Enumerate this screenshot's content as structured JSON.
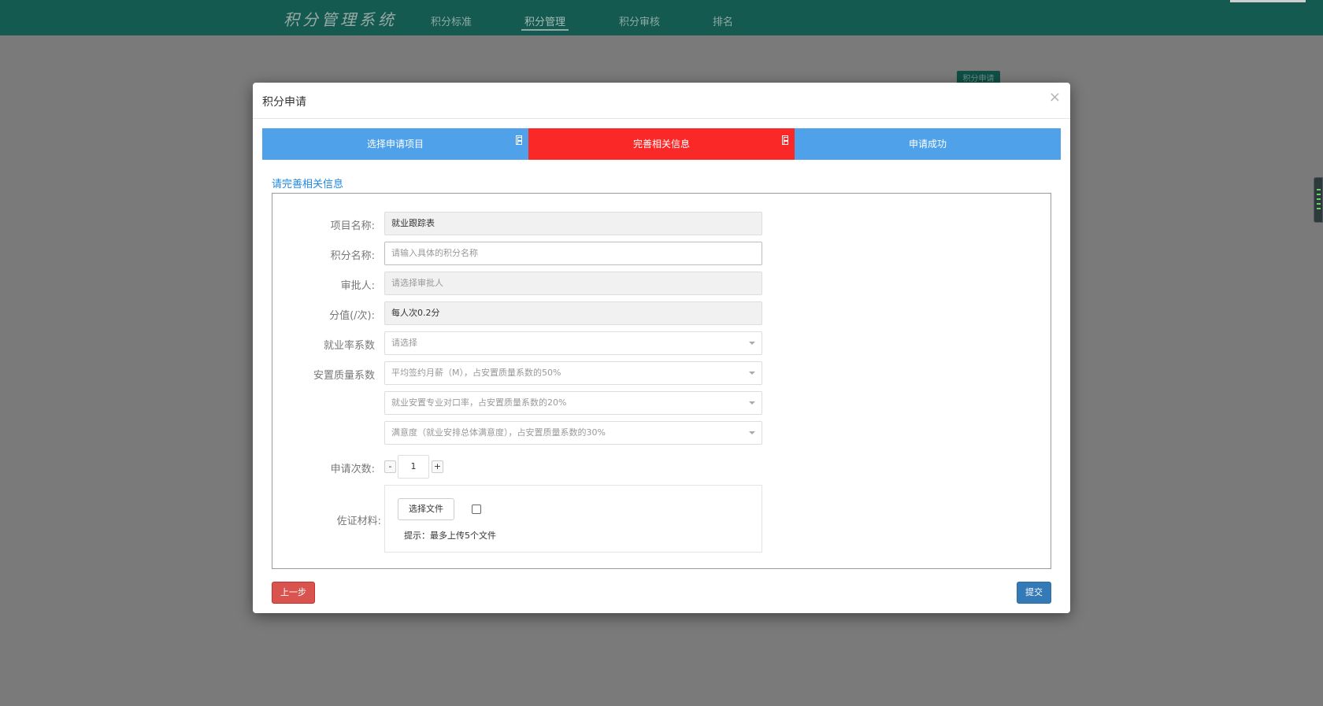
{
  "nav": {
    "brand": "积分管理系统",
    "items": [
      {
        "label": "积分标准"
      },
      {
        "label": "积分管理"
      },
      {
        "label": "积分审核"
      },
      {
        "label": "排名"
      }
    ],
    "active_index": 1
  },
  "background": {
    "apply_button": "积分申请"
  },
  "modal": {
    "title": "积分申请",
    "close": "×",
    "steps": [
      {
        "label": "选择申请项目"
      },
      {
        "label": "完善相关信息"
      },
      {
        "label": "申请成功"
      }
    ],
    "current_step": 1,
    "section_title": "请完善相关信息",
    "form": {
      "project_name": {
        "label": "项目名称:",
        "value": "就业跟踪表"
      },
      "score_name": {
        "label": "积分名称:",
        "placeholder": "请输入具体的积分名称"
      },
      "approver": {
        "label": "审批人:",
        "placeholder": "请选择审批人"
      },
      "score_value": {
        "label": "分值(/次):",
        "value": "每人次0.2分"
      },
      "employment_rate": {
        "label": "就业率系数",
        "placeholder": "请选择"
      },
      "placement_quality": {
        "label": "安置质量系数",
        "selects": [
          "平均签约月薪（M），占安置质量系数的50%",
          "就业安置专业对口率，占安置质量系数的20%",
          "满意度（就业安排总体满意度），占安置质量系数的30%"
        ]
      },
      "apply_count": {
        "label": "申请次数:",
        "minus": "-",
        "value": "1",
        "plus": "+"
      },
      "evidence": {
        "label": "佐证材料:",
        "choose_button": "选择文件",
        "hint": "提示：最多上传5个文件"
      }
    },
    "buttons": {
      "prev": "上一步",
      "submit": "提交"
    }
  },
  "colors": {
    "topbar": "#145a50",
    "step": "#4fa1ea",
    "step_current": "#fb2828",
    "danger": "#d9534f",
    "primary": "#337ab7"
  }
}
